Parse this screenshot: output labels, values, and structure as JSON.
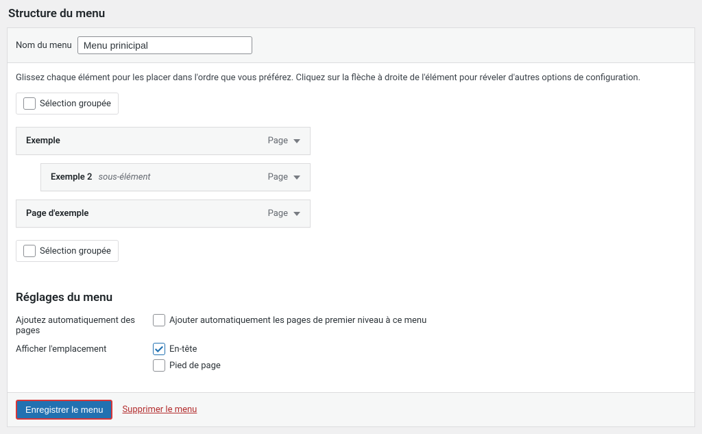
{
  "section_title": "Structure du menu",
  "menu_name_label": "Nom du menu",
  "menu_name_value": "Menu prinicipal",
  "instructions": "Glissez chaque élément pour les placer dans l'ordre que vous préférez. Cliquez sur la flèche à droite de l'élément pour réveler d'autres options de configuration.",
  "bulk_select_label": "Sélection groupée",
  "menu_items": [
    {
      "title": "Exemple",
      "sub": "",
      "type": "Page",
      "depth": 0
    },
    {
      "title": "Exemple 2",
      "sub": "sous-élément",
      "type": "Page",
      "depth": 1
    },
    {
      "title": "Page d'exemple",
      "sub": "",
      "type": "Page",
      "depth": 0
    }
  ],
  "settings_title": "Réglages du menu",
  "auto_add_label": "Ajoutez automatiquement des pages",
  "auto_add_option": "Ajouter automatiquement les pages de premier niveau à ce menu",
  "display_location_label": "Afficher l'emplacement",
  "locations": [
    {
      "label": "En-tête",
      "checked": true
    },
    {
      "label": "Pied de page",
      "checked": false
    }
  ],
  "save_button": "Enregistrer le menu",
  "delete_link": "Supprimer le menu"
}
